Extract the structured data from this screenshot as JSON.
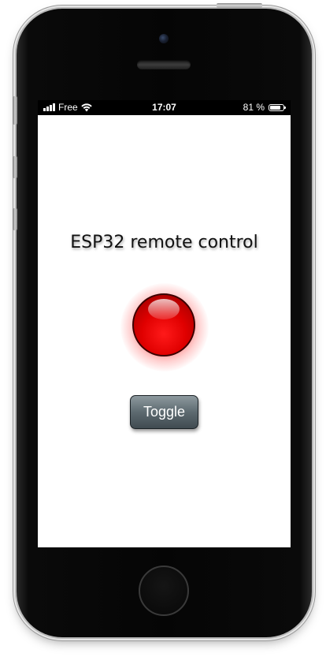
{
  "status_bar": {
    "carrier": "Free",
    "time": "17:07",
    "battery_text": "81 %",
    "battery_level": 0.81,
    "signal_icon": "signal-bars-icon",
    "wifi_icon": "wifi-icon",
    "battery_icon": "battery-icon"
  },
  "app": {
    "title": "ESP32 remote control",
    "led_state": "on",
    "led_color": "#e00000",
    "toggle_label": "Toggle"
  },
  "colors": {
    "button_top": "#8e9a9f",
    "button_bottom": "#404b51",
    "status_bar_bg": "#000000"
  }
}
